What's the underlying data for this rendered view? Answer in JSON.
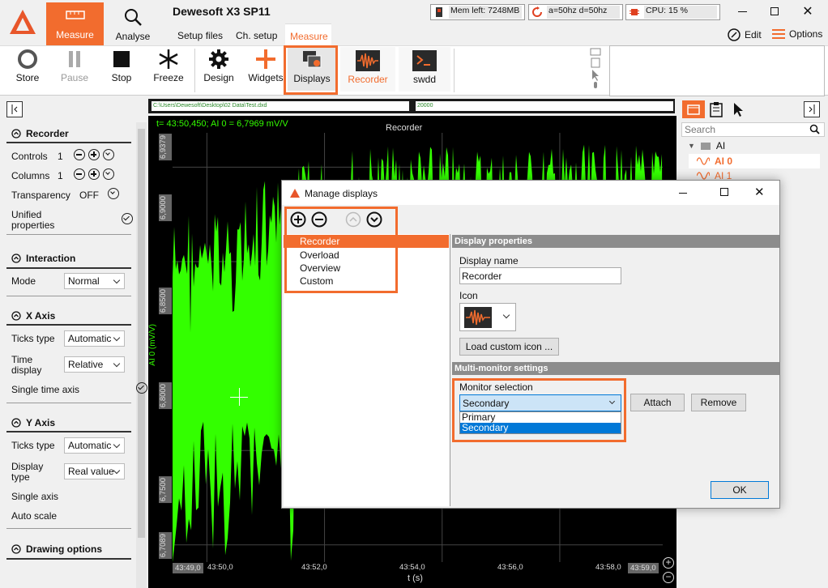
{
  "app": {
    "title": "Dewesoft X3 SP11"
  },
  "topbar": {
    "measure_label": "Measure",
    "analyse_label": "Analyse",
    "tabs": [
      "Setup files",
      "Ch. setup",
      "Measure"
    ],
    "edit_label": "Edit",
    "options_label": "Options"
  },
  "status": {
    "mem": "Mem left: 7248MB",
    "rate": "a=50hz d=50hz",
    "cpu": "CPU: 15 %"
  },
  "toolbar": {
    "store": "Store",
    "pause": "Pause",
    "stop": "Stop",
    "freeze": "Freeze",
    "design": "Design",
    "widgets": "Widgets",
    "displays": "Displays",
    "recorder": "Recorder",
    "swdd": "swdd"
  },
  "left_panel": {
    "recorder_title": "Recorder",
    "controls_label": "Controls",
    "controls_value": "1",
    "columns_label": "Columns",
    "columns_value": "1",
    "transparency_label": "Transparency",
    "transparency_value": "OFF",
    "unified_label_1": "Unified",
    "unified_label_2": "properties",
    "interaction_title": "Interaction",
    "mode_label": "Mode",
    "mode_value": "Normal",
    "xaxis_title": "X Axis",
    "ticks_type_label": "Ticks type",
    "ticks_type_value": "Automatic",
    "time_display_label_1": "Time",
    "time_display_label_2": "display",
    "time_display_value": "Relative",
    "single_time_axis_label": "Single time axis",
    "yaxis_title": "Y Axis",
    "y_ticks_type_label": "Ticks type",
    "y_ticks_type_value": "Automatic",
    "display_type_label_1": "Display",
    "display_type_label_2": "type",
    "display_type_value": "Real value",
    "single_axis_label": "Single axis",
    "auto_scale_label": "Auto scale",
    "drawing_options_title": "Drawing options"
  },
  "file_bar": {
    "path": "C:\\Users\\Dewesoft\\Desktop\\02 Data\\Test.dxd",
    "count": "20000"
  },
  "chart": {
    "cursor_readout": "t= 43:50,450; AI 0 = 6,7969 mV/V",
    "title": "Recorder",
    "ylabel": "AI 0 (mV/V)",
    "xlabel": "t (s)",
    "color": "#33ff00"
  },
  "chart_data": {
    "type": "area",
    "title": "Recorder",
    "xlabel": "t (s)",
    "ylabel": "AI 0 (mV/V)",
    "x_ticks": [
      "43:49,0",
      "43:50,0",
      "43:52,0",
      "43:54,0",
      "43:56,0",
      "43:58,0",
      "43:59,0"
    ],
    "y_ticks": [
      "6,9379",
      "6,9000",
      "6,8500",
      "6,8000",
      "6,7500",
      "6,7089"
    ],
    "ylim": [
      6.7089,
      6.9379
    ],
    "xlim": [
      "43:49,0",
      "43:59,0"
    ]
  },
  "right_panel": {
    "search_placeholder": "Search",
    "group": "AI",
    "items": [
      "AI 0",
      "AI 1"
    ]
  },
  "dialog": {
    "title": "Manage displays",
    "list": [
      "Recorder",
      "Overload",
      "Overview",
      "Custom"
    ],
    "display_properties": "Display properties",
    "display_name_label": "Display name",
    "display_name_value": "Recorder",
    "icon_label": "Icon",
    "load_icon": "Load custom icon ...",
    "multi_monitor": "Multi-monitor settings",
    "monitor_selection_label": "Monitor selection",
    "monitor_value": "Secondary",
    "monitor_options": [
      "Primary",
      "Secondary"
    ],
    "attach": "Attach",
    "remove": "Remove",
    "ok": "OK"
  },
  "colors": {
    "accent": "#f26c2e",
    "selection": "#0078d7"
  }
}
